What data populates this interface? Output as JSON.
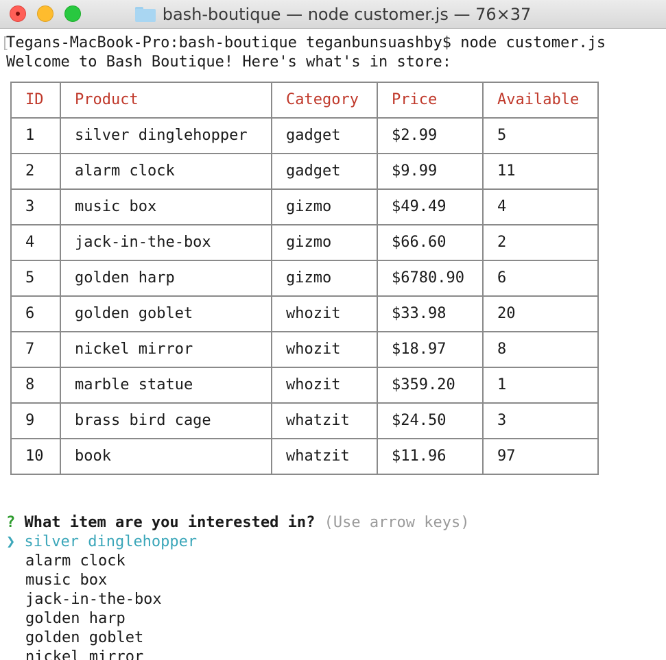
{
  "window": {
    "title": "bash-boutique — node customer.js — 76×37"
  },
  "terminal": {
    "prompt_line": "Tegans-MacBook-Pro:bash-boutique teganbunsuashby$ node customer.js",
    "welcome_line": "Welcome to Bash Boutique! Here's what's in store:",
    "table": {
      "headers": [
        "ID",
        "Product",
        "Category",
        "Price",
        "Available"
      ],
      "rows": [
        [
          "1",
          "silver dinglehopper",
          "gadget",
          "$2.99",
          "5"
        ],
        [
          "2",
          "alarm clock",
          "gadget",
          "$9.99",
          "11"
        ],
        [
          "3",
          "music box",
          "gizmo",
          "$49.49",
          "4"
        ],
        [
          "4",
          "jack-in-the-box",
          "gizmo",
          "$66.60",
          "2"
        ],
        [
          "5",
          "golden harp",
          "gizmo",
          "$6780.90",
          "6"
        ],
        [
          "6",
          "golden goblet",
          "whozit",
          "$33.98",
          "20"
        ],
        [
          "7",
          "nickel mirror",
          "whozit",
          "$18.97",
          "8"
        ],
        [
          "8",
          "marble statue",
          "whozit",
          "$359.20",
          "1"
        ],
        [
          "9",
          "brass bird cage",
          "whatzit",
          "$24.50",
          "3"
        ],
        [
          "10",
          "book",
          "whatzit",
          "$11.96",
          "97"
        ]
      ]
    },
    "question": {
      "marker": "?",
      "text": "What item are you interested in?",
      "hint": "(Use arrow keys)"
    },
    "menu": {
      "pointer": "❯",
      "selected": "silver dinglehopper",
      "options": [
        "alarm clock",
        "music box",
        "jack-in-the-box",
        "golden harp",
        "golden goblet",
        "nickel mirror"
      ]
    }
  },
  "colors": {
    "header_text": "#c0392b",
    "question_mark": "#2d9b2d",
    "selected_option": "#3aa6b9",
    "hint_text": "#9a9a9a"
  }
}
